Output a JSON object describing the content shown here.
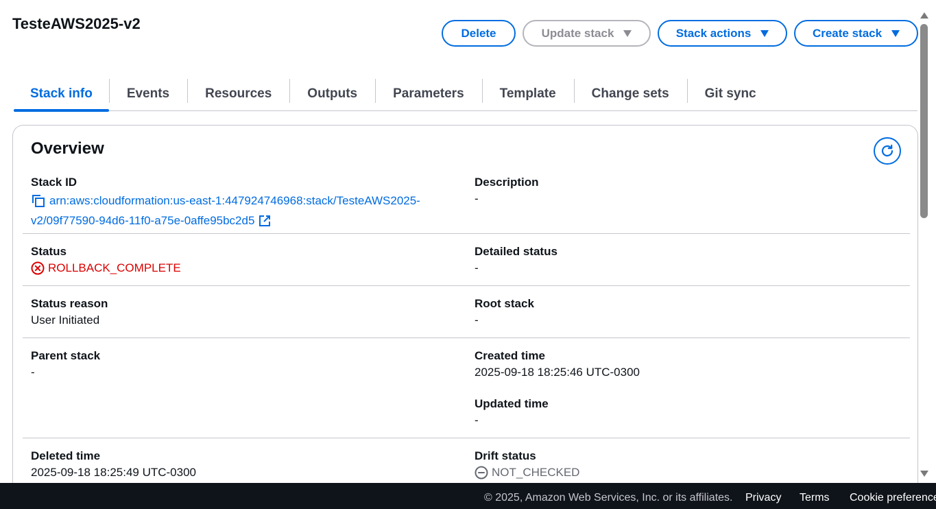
{
  "header": {
    "title": "TesteAWS2025-v2",
    "buttons": {
      "delete": "Delete",
      "update": "Update stack",
      "actions": "Stack actions",
      "create": "Create stack"
    }
  },
  "tabs": [
    {
      "label": "Stack info",
      "active": true
    },
    {
      "label": "Events"
    },
    {
      "label": "Resources"
    },
    {
      "label": "Outputs"
    },
    {
      "label": "Parameters"
    },
    {
      "label": "Template"
    },
    {
      "label": "Change sets"
    },
    {
      "label": "Git sync"
    }
  ],
  "overview": {
    "title": "Overview",
    "stack_id": {
      "label": "Stack ID",
      "line1": "arn:aws:cloudformation:us-east-1:447924746968:stack/TesteAWS2025-",
      "line2": "v2/09f77590-94d6-11f0-a75e-0affe95bc2d5"
    },
    "description": {
      "label": "Description",
      "value": "-"
    },
    "status": {
      "label": "Status",
      "value": "ROLLBACK_COMPLETE",
      "color": "#db0000"
    },
    "detailed_status": {
      "label": "Detailed status",
      "value": "-"
    },
    "status_reason": {
      "label": "Status reason",
      "value": "User Initiated"
    },
    "root_stack": {
      "label": "Root stack",
      "value": "-"
    },
    "parent_stack": {
      "label": "Parent stack",
      "value": "-"
    },
    "created_time": {
      "label": "Created time",
      "value": "2025-09-18 18:25:46 UTC-0300"
    },
    "updated_time": {
      "label": "Updated time",
      "value": "-"
    },
    "deleted_time": {
      "label": "Deleted time",
      "value": "2025-09-18 18:25:49 UTC-0300"
    },
    "drift_status": {
      "label": "Drift status",
      "value": "NOT_CHECKED"
    }
  },
  "footer": {
    "copyright": "© 2025, Amazon Web Services, Inc. or its affiliates.",
    "privacy": "Privacy",
    "terms": "Terms",
    "cookies": "Cookie preferences"
  },
  "colors": {
    "accent": "#006ce0",
    "error": "#db0000",
    "text": "#0f141a",
    "footer_bg": "#0f141a"
  }
}
